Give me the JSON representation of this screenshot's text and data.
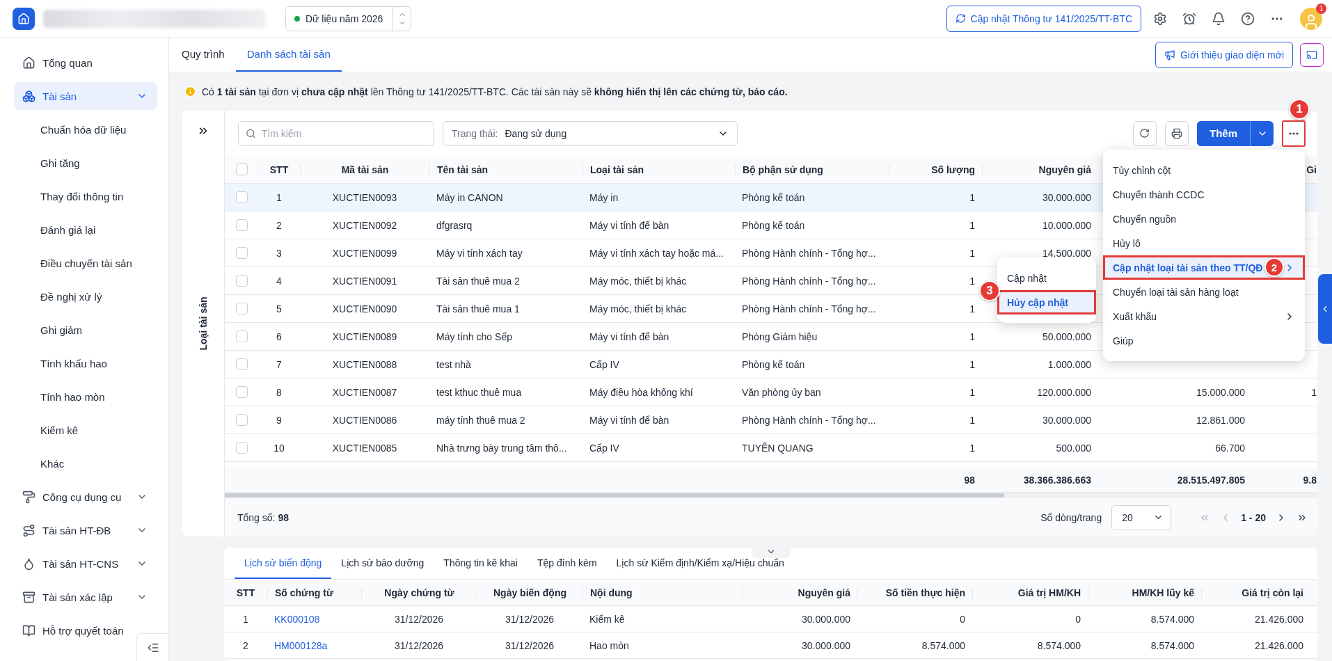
{
  "topbar": {
    "data_chip": "Dữ liệu năm 2026",
    "update_button": "Cập nhật Thông tư 141/2025/TT-BTC",
    "avatar_badge": "1"
  },
  "sidebar": {
    "items": [
      {
        "label": "Tổng quan",
        "selected": false,
        "kind": "link"
      },
      {
        "label": "Tài sản",
        "selected": true,
        "kind": "group",
        "children": [
          {
            "label": "Chuẩn hóa dữ liệu"
          },
          {
            "label": "Ghi tăng"
          },
          {
            "label": "Thay đổi thông tin"
          },
          {
            "label": "Đánh giá lại"
          },
          {
            "label": "Điều chuyển tài sản"
          },
          {
            "label": "Đề nghị xử lý"
          },
          {
            "label": "Ghi giảm"
          },
          {
            "label": "Tính khấu hao"
          },
          {
            "label": "Tính hao mòn"
          },
          {
            "label": "Kiểm kê"
          },
          {
            "label": "Khác"
          }
        ]
      },
      {
        "label": "Công cụ dụng cụ",
        "selected": false,
        "kind": "group"
      },
      {
        "label": "Tài sản HT-ĐB",
        "selected": false,
        "kind": "group"
      },
      {
        "label": "Tài sản HT-CNS",
        "selected": false,
        "kind": "group"
      },
      {
        "label": "Tài sản xác lập",
        "selected": false,
        "kind": "group"
      },
      {
        "label": "Hỗ trợ quyết toán",
        "selected": false,
        "kind": "link"
      }
    ]
  },
  "tabs": [
    {
      "label": "Quy trình",
      "selected": false
    },
    {
      "label": "Danh sách tài sản",
      "selected": true
    }
  ],
  "intro_button": "Giới thiệu giao diện mới",
  "notice": "Có **1 tài sản** tại đơn vị **chưa cập nhật** lên Thông tư 141/2025/TT-BTC. Các tài sản này sẽ **không hiển thị lên các chứng từ, báo cáo.**",
  "side_panel": {
    "title": "Loại tài sản"
  },
  "toolbar": {
    "search": {
      "placeholder": "Tìm kiếm"
    },
    "status_filter": {
      "label": "Trạng thái:",
      "value": "Đang sử dụng"
    },
    "add_button": "Thêm",
    "more_callout": "1"
  },
  "table": {
    "all_checked": false,
    "headers": {
      "stt": "STT",
      "code": "Mã tài sản",
      "name": "Tên tài sản",
      "type": "Loại tài sản",
      "dept": "Bộ phận sử dụng",
      "qty": "Số lượng",
      "price": "Nguyên giá",
      "column_8": "Gi"
    },
    "rows": [
      {
        "selected": true,
        "checked": false,
        "stt": "1",
        "code": "XUCTIEN0093",
        "name": "Máy in CANON",
        "type": "Máy in",
        "dept": "Phòng kế toán",
        "qty": "1",
        "price": "30.000.000"
      },
      {
        "selected": false,
        "checked": false,
        "stt": "2",
        "code": "XUCTIEN0092",
        "name": "dfgrasrq",
        "type": "Máy vi tính để bàn",
        "dept": "Phòng kế toán",
        "qty": "1",
        "price": "10.000.000"
      },
      {
        "selected": false,
        "checked": false,
        "stt": "3",
        "code": "XUCTIEN0099",
        "name": "Máy vi tính xách tay",
        "type": "Máy vi tính xách tay hoặc má...",
        "dept": "Phòng Hành chính - Tổng hợ...",
        "qty": "1",
        "price": "14.500.000"
      },
      {
        "selected": false,
        "checked": false,
        "stt": "4",
        "code": "XUCTIEN0091",
        "name": "Tài sản thuê mua 2",
        "type": "Máy móc, thiết bị khác",
        "dept": "Phòng Hành chính - Tổng hợ...",
        "qty": "1"
      },
      {
        "selected": false,
        "checked": false,
        "stt": "5",
        "code": "XUCTIEN0090",
        "name": "Tài sản thuê mua 1",
        "type": "Máy móc, thiết bị khác",
        "dept": "Phòng Hành chính - Tổng hợ...",
        "qty": "1"
      },
      {
        "selected": false,
        "checked": false,
        "stt": "6",
        "code": "XUCTIEN0089",
        "name": "Máy tính cho Sếp",
        "type": "Máy vi tính để bàn",
        "dept": "Phòng Giám hiệu",
        "qty": "1",
        "price": "50.000.000"
      },
      {
        "selected": false,
        "checked": false,
        "stt": "7",
        "code": "XUCTIEN0088",
        "name": "test nhà",
        "type": "Cấp IV",
        "dept": "Phòng kế toán",
        "qty": "1",
        "price": "1.000.000"
      },
      {
        "selected": false,
        "checked": false,
        "stt": "8",
        "code": "XUCTIEN0087",
        "name": "test kthuc thuê mua",
        "type": "Máy điều hòa không khí",
        "dept": "Văn phòng ủy ban",
        "qty": "1",
        "price": "120.000.000",
        "column_7": "15.000.000",
        "column_8": "1"
      },
      {
        "selected": false,
        "checked": false,
        "stt": "9",
        "code": "XUCTIEN0086",
        "name": "máy tính thuê mua 2",
        "type": "Máy vi tính để bàn",
        "dept": "Phòng Hành chính - Tổng hợ...",
        "qty": "1",
        "price": "30.000.000",
        "column_7": "12.861.000"
      },
      {
        "selected": false,
        "checked": false,
        "stt": "10",
        "code": "XUCTIEN0085",
        "name": "Nhà trưng bày trung tâm thô...",
        "type": "Cấp IV",
        "dept": "TUYÊN QUANG",
        "qty": "1",
        "price": "500.000",
        "column_7": "66.700"
      }
    ],
    "totals": {
      "qty": "98",
      "price": "38.366.386.663",
      "column_7": "28.515.497.805",
      "column_8": "9.8"
    }
  },
  "pagination": {
    "total": "Tổng số: **98**",
    "rows_label": "Số dòng/trang",
    "page_size": "20",
    "range": "1 - 20"
  },
  "menu": {
    "items": [
      {
        "label": "Tùy chỉnh cột",
        "selected": false
      },
      {
        "label": "Chuyển thành CCDC",
        "selected": false
      },
      {
        "label": "Chuyển nguồn",
        "selected": false
      },
      {
        "label": "Hủy lô",
        "selected": false
      },
      {
        "label": "Cập nhật loại tài sản theo TT/QĐ",
        "selected": true,
        "submenu": true,
        "callout": "2"
      },
      {
        "label": "Chuyển loại tài sản hàng loạt",
        "selected": false
      },
      {
        "label": "Xuất khẩu",
        "selected": false,
        "submenu": true
      },
      {
        "label": "Giúp",
        "selected": false
      }
    ],
    "submenu": [
      {
        "label": "Cập nhật",
        "selected": false
      },
      {
        "label": "Hủy cập nhật",
        "selected": true,
        "callout": "3"
      }
    ]
  },
  "detail": {
    "tabs": [
      {
        "label": "Lịch sử biến động",
        "selected": true
      },
      {
        "label": "Lịch sử bảo dưỡng",
        "selected": false
      },
      {
        "label": "Thông tin kê khai",
        "selected": false
      },
      {
        "label": "Tệp đính kèm",
        "selected": false
      },
      {
        "label": "Lịch sử Kiểm định/Kiểm xạ/Hiệu chuẩn",
        "selected": false
      }
    ],
    "columns": [
      "STT",
      "Số chứng từ",
      "Ngày chứng từ",
      "Ngày biến động",
      "Nội dung",
      "Nguyên giá",
      "Số tiền thực hiện",
      "Giá trị HM/KH",
      "HM/KH lũy kế",
      "Giá trị còn lại"
    ],
    "rows": [
      [
        "1",
        "KK000108",
        "31/12/2026",
        "31/12/2026",
        "Kiểm kê",
        "30.000.000",
        "0",
        "0",
        "8.574.000",
        "21.426.000"
      ],
      [
        "2",
        "HM000128a",
        "31/12/2026",
        "31/12/2026",
        "Hao mòn",
        "30.000.000",
        "8.574.000",
        "8.574.000",
        "8.574.000",
        "21.426.000"
      ]
    ]
  }
}
